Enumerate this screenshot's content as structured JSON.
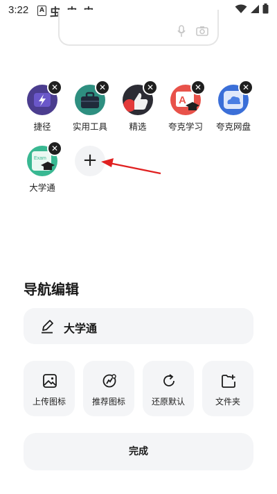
{
  "status_bar": {
    "time": "3:22",
    "app_icon_letter": "A",
    "bug_glyph": "虫"
  },
  "search_card": {
    "icons": [
      "mic-icon",
      "camera-icon"
    ]
  },
  "shortcuts": [
    {
      "label": "捷径",
      "icon": "lightning-folder-icon",
      "color": "#4b3d8f"
    },
    {
      "label": "实用工具",
      "icon": "toolbox-icon",
      "color": "#2e8f80"
    },
    {
      "label": "精选",
      "icon": "thumbs-up-icon",
      "color": "#2c2c34"
    },
    {
      "label": "夸克学习",
      "icon": "graduation-cap-icon",
      "color": "#e8524a"
    },
    {
      "label": "夸克网盘",
      "icon": "cloud-drive-icon",
      "color": "#3b6fd8"
    },
    {
      "label": "大学通",
      "icon": "university-icon",
      "color": "#39b892"
    }
  ],
  "remove_glyph": "✕",
  "add_button": {
    "label": "+"
  },
  "panel": {
    "title": "导航编辑",
    "name_value": "大学通",
    "actions": [
      {
        "label": "上传图标",
        "icon": "image-upload-icon"
      },
      {
        "label": "推荐图标",
        "icon": "recommend-icon"
      },
      {
        "label": "还原默认",
        "icon": "restore-icon"
      },
      {
        "label": "文件夹",
        "icon": "folder-add-icon"
      }
    ],
    "done_label": "完成"
  },
  "colors": {
    "arrow": "#e02020",
    "card_bg": "#f4f5f7",
    "badge": "#1f1f1f"
  }
}
